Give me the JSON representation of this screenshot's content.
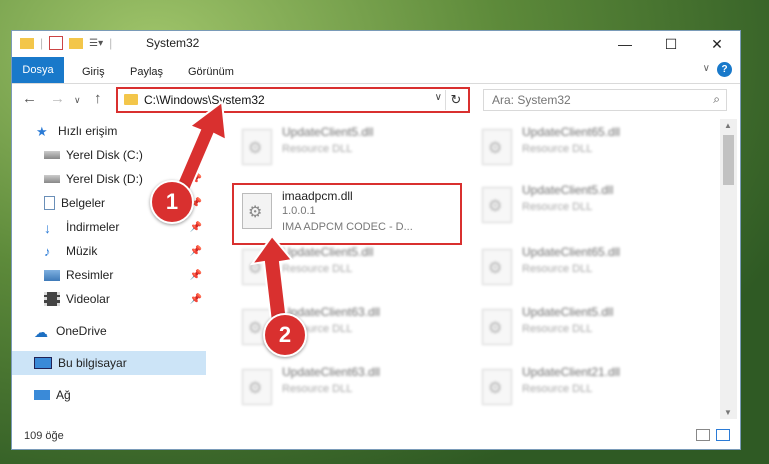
{
  "window": {
    "title": "System32",
    "ribbon_tabs": [
      "Dosya",
      "Giriş",
      "Paylaş",
      "Görünüm"
    ],
    "address_path": "C:\\Windows\\System32",
    "search_placeholder": "Ara: System32"
  },
  "nav": [
    {
      "label": "Hızlı erişim",
      "icon": "star-icon"
    },
    {
      "label": "Yerel Disk (C:)",
      "icon": "drive-icon"
    },
    {
      "label": "Yerel Disk (D:)",
      "icon": "drive-icon"
    },
    {
      "label": "Belgeler",
      "icon": "document-icon"
    },
    {
      "label": "İndirmeler",
      "icon": "download-icon"
    },
    {
      "label": "Müzik",
      "icon": "music-icon"
    },
    {
      "label": "Resimler",
      "icon": "pictures-icon"
    },
    {
      "label": "Videolar",
      "icon": "video-icon"
    },
    {
      "label": "OneDrive",
      "icon": "cloud-icon"
    },
    {
      "label": "Bu bilgisayar",
      "icon": "computer-icon"
    },
    {
      "label": "Ağ",
      "icon": "network-icon"
    }
  ],
  "files": [
    {
      "name": "UpdateClient5.dll",
      "type": "Resource DLL"
    },
    {
      "name": "UpdateClient65.dll",
      "type": "Resource DLL"
    },
    {
      "name": "imaadpcm.dll",
      "version": "1.0.0.1",
      "desc": "IMA ADPCM CODEC - D..."
    },
    {
      "name": "UpdateClient5.dll",
      "type": "Resource DLL"
    },
    {
      "name": "UpdateClient5.dll",
      "type": "Resource DLL"
    },
    {
      "name": "UpdateClient65.dll",
      "type": "Resource DLL"
    },
    {
      "name": "UpdateClient63.dll",
      "type": "Resource DLL"
    },
    {
      "name": "UpdateClient5.dll",
      "type": "Resource DLL"
    },
    {
      "name": "UpdateClient63.dll",
      "type": "Resource DLL"
    },
    {
      "name": "UpdateClient21.dll",
      "type": "Resource DLL"
    }
  ],
  "status": {
    "count": "109 öğe"
  },
  "callouts": [
    "1",
    "2"
  ],
  "colors": {
    "accent": "#1979ca",
    "highlight": "#d9302f",
    "selected": "#cce4f7"
  }
}
